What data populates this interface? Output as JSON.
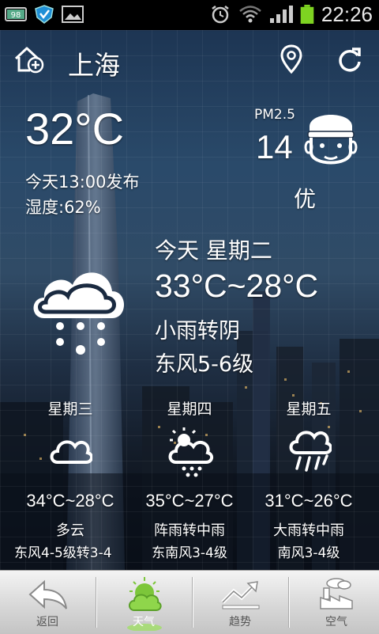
{
  "status_bar": {
    "battery_level": "98",
    "time": "22:26"
  },
  "header": {
    "city": "上海"
  },
  "current": {
    "temperature": "32°C",
    "published": "今天13:00发布",
    "humidity": "湿度:62%"
  },
  "pm25": {
    "label": "PM2.5",
    "value": "14",
    "quality": "优"
  },
  "today": {
    "day": "今天 星期二",
    "temp_range": "33°C~28°C",
    "condition": "小雨转阴",
    "wind": "东风5-6级"
  },
  "forecast": [
    {
      "day": "星期三",
      "temp_range": "34°C~28°C",
      "condition": "多云",
      "wind": "东风4-5级转3-4",
      "icon": "cloud-icon"
    },
    {
      "day": "星期四",
      "temp_range": "35°C~27°C",
      "condition": "阵雨转中雨",
      "wind": "东南风3-4级",
      "icon": "sun-cloud-rain-icon"
    },
    {
      "day": "星期五",
      "temp_range": "31°C~26°C",
      "condition": "大雨转中雨",
      "wind": "南风3-4级",
      "icon": "heavy-rain-icon"
    }
  ],
  "nav": [
    {
      "label": "返回",
      "icon": "back-arrow-icon"
    },
    {
      "label": "天气",
      "icon": "weather-icon"
    },
    {
      "label": "趋势",
      "icon": "trend-icon"
    },
    {
      "label": "空气",
      "icon": "air-factory-icon"
    }
  ],
  "colors": {
    "status_bar": "#000000",
    "battery": "#7ed321",
    "nav_active": "#7cc63a"
  }
}
